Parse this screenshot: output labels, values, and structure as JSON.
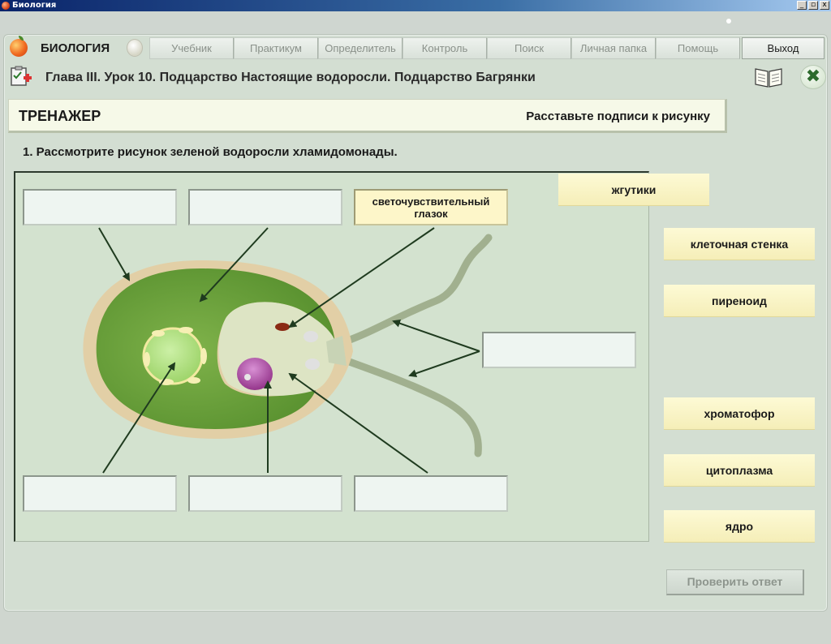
{
  "window": {
    "title": "Биология",
    "controls": {
      "minimize": "_",
      "restore": "▫",
      "close": "x"
    }
  },
  "nav": {
    "brand": "БИОЛОГИЯ",
    "items": [
      {
        "label": "Учебник"
      },
      {
        "label": "Практикум"
      },
      {
        "label": "Определитель"
      },
      {
        "label": "Контроль"
      },
      {
        "label": "Поиск"
      },
      {
        "label": "Личная папка"
      },
      {
        "label": "Помощь"
      },
      {
        "label": "Выход"
      }
    ]
  },
  "chapter": {
    "heading": "Глава III. Урок 10. Подцарство Настоящие водоросли. Подцарство Багрянки",
    "close_icon": "close-icon",
    "book_icon": "book-icon"
  },
  "trainer": {
    "title": "ТРЕНАЖЕР",
    "task": "Расставьте подписи к рисунку"
  },
  "question": "1. Рассмотрите рисунок зеленой водоросли хламидомонады.",
  "drop_boxes": [
    {
      "value": ""
    },
    {
      "value": ""
    },
    {
      "value": "светочувствительный глазок"
    },
    {
      "value": ""
    },
    {
      "value": ""
    },
    {
      "value": ""
    },
    {
      "value": ""
    }
  ],
  "labels": [
    {
      "text": "жгутики"
    },
    {
      "text": "клеточная стенка"
    },
    {
      "text": "пиреноид"
    },
    {
      "text": "хроматофор"
    },
    {
      "text": "цитоплазма"
    },
    {
      "text": "ядро"
    }
  ],
  "check_button": "Проверить ответ",
  "colors": {
    "panel_bg": "#d3e2cf",
    "chromatophore": "#6aa13a",
    "cell_wall": "#e2cfa6",
    "nucleus": "#a13a94",
    "chip_bg": "#f8f2c2"
  }
}
